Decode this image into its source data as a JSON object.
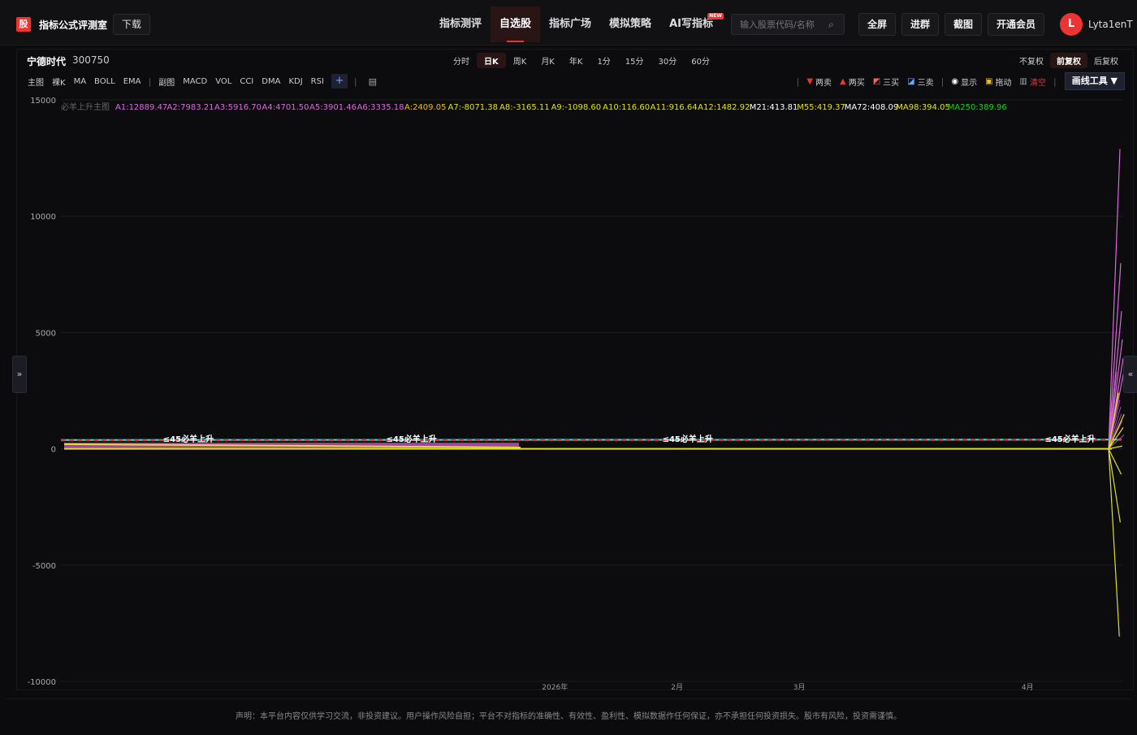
{
  "brand": {
    "logo_glyph": "股",
    "title": "指标公式评测室",
    "download": "下载"
  },
  "nav": [
    {
      "label": "指标测评",
      "active": false
    },
    {
      "label": "自选股",
      "active": true
    },
    {
      "label": "指标广场",
      "active": false
    },
    {
      "label": "模拟策略",
      "active": false
    },
    {
      "label": "AI写指标",
      "active": false,
      "badge": "NEW"
    }
  ],
  "search": {
    "placeholder": "输入股票代码/名称"
  },
  "top_buttons": {
    "fullscreen": "全屏",
    "join_group": "进群",
    "screenshot": "截图",
    "vip": "开通会员"
  },
  "user": {
    "avatar_letter": "L",
    "name": "Lyta1enT"
  },
  "stock": {
    "name": "宁德时代",
    "code": "300750"
  },
  "periods": [
    {
      "label": "分时",
      "active": false
    },
    {
      "label": "日K",
      "active": true
    },
    {
      "label": "周K",
      "active": false
    },
    {
      "label": "月K",
      "active": false
    },
    {
      "label": "年K",
      "active": false
    },
    {
      "label": "1分",
      "active": false
    },
    {
      "label": "15分",
      "active": false
    },
    {
      "label": "30分",
      "active": false
    },
    {
      "label": "60分",
      "active": false
    }
  ],
  "adjust": [
    {
      "label": "不复权",
      "active": false
    },
    {
      "label": "前复权",
      "active": true
    },
    {
      "label": "后复权",
      "active": false
    }
  ],
  "indicators_main": [
    "主图",
    "裸K",
    "MA",
    "BOLL",
    "EMA"
  ],
  "indicators_sub": [
    "副图",
    "MACD",
    "VOL",
    "CCI",
    "DMA",
    "KDJ",
    "RSI"
  ],
  "plus_label": "+",
  "drawing": {
    "two_sell": "两卖",
    "two_buy": "两买",
    "three_buy": "三买",
    "three_sell": "三卖",
    "show": "显示",
    "drag": "拖动",
    "clear": "清空",
    "tool_button": "画线工具 ▼"
  },
  "colors": {
    "accent": "#e33333",
    "bg": "#0b0b0d"
  },
  "chart_data": {
    "type": "line",
    "title": "",
    "ylim": [
      -10000,
      15000
    ],
    "yticks": [
      15000,
      10000,
      5000,
      0,
      -5000,
      -10000
    ],
    "xticks": [
      "2026年",
      "2月",
      "3月",
      "4月"
    ],
    "legend_title": "必羊上升主图",
    "legend": [
      {
        "label": "A1:12889.47",
        "color": "#d86bd8"
      },
      {
        "label": "A2:7983.21",
        "color": "#d86bd8"
      },
      {
        "label": "A3:5916.70",
        "color": "#d86bd8"
      },
      {
        "label": "A4:4701.50",
        "color": "#d86bd8"
      },
      {
        "label": "A5:3901.46",
        "color": "#d86bd8"
      },
      {
        "label": "A6:3335.18",
        "color": "#d86bd8"
      },
      {
        "label": "A:2409.05",
        "color": "#e0c020"
      },
      {
        "label": "A7:-8071.38",
        "color": "#e0e020"
      },
      {
        "label": "A8:-3165.11",
        "color": "#e0e020"
      },
      {
        "label": "A9:-1098.60",
        "color": "#e0e020"
      },
      {
        "label": "A10:116.60",
        "color": "#e0e020"
      },
      {
        "label": "A11:916.64",
        "color": "#e0e020"
      },
      {
        "label": "A12:1482.92",
        "color": "#e0e020"
      },
      {
        "label": "M21:413.81",
        "color": "#ffffff"
      },
      {
        "label": "M55:419.37",
        "color": "#e0e020"
      },
      {
        "label": "MA72:408.09",
        "color": "#ffffff"
      },
      {
        "label": "MA98:394.05",
        "color": "#e0e020"
      },
      {
        "label": "MA250:389.96",
        "color": "#22cc22"
      }
    ],
    "annotations": [
      "≤45必羊上升",
      "≤45必羊上升",
      "≤45必羊上升",
      "≤45必羊上升"
    ],
    "series": [
      {
        "name": "M21",
        "values": [
          380,
          385,
          390,
          395,
          400,
          405,
          410,
          414
        ]
      },
      {
        "name": "A12",
        "values": [
          120,
          110,
          100,
          90,
          80,
          70,
          60,
          1483
        ]
      }
    ],
    "spike_values_pink": [
      12889.47,
      7983.21,
      5916.7,
      4701.5,
      3901.46,
      3335.18
    ],
    "spike_values_yellow": [
      2409.05,
      -8071.38,
      -3165.11,
      -1098.6,
      116.6,
      916.64,
      1482.92
    ]
  },
  "footer": "声明：本平台内容仅供学习交流，非投资建议。用户操作风险自担；平台不对指标的准确性、有效性、盈利性、模拟数据作任何保证，亦不承担任何投资损失。股市有风险，投资需谨慎。"
}
